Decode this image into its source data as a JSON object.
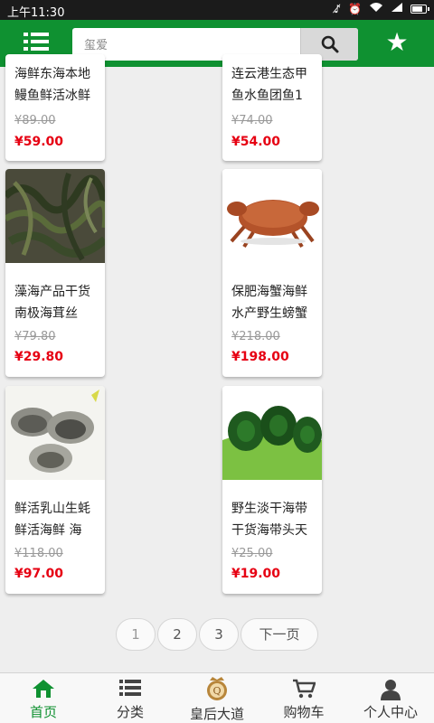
{
  "status_bar": {
    "time": "上午11:30"
  },
  "header": {
    "search_placeholder": "玺爱",
    "search_icon": "search-icon",
    "menu_icon": "list-icon",
    "favorite_icon": "star-icon"
  },
  "products": [
    {
      "name": "海鲜东海本地鳗鱼鲜活冰鲜",
      "old_price": "¥89.00",
      "price": "¥59.00",
      "image": "eel-photo"
    },
    {
      "name": "连云港生态甲鱼水鱼团鱼1",
      "old_price": "¥74.00",
      "price": "¥54.00",
      "image": "turtle-photo"
    },
    {
      "name": "藻海产品干货南极海茸丝",
      "old_price": "¥79.80",
      "price": "¥29.80",
      "image": "seaweed-photo"
    },
    {
      "name": "保肥海蟹海鲜水产野生螃蟹",
      "old_price": "¥218.00",
      "price": "¥198.00",
      "image": "crab-photo"
    },
    {
      "name": "鲜活乳山生蚝鲜活海鲜 海",
      "old_price": "¥118.00",
      "price": "¥97.00",
      "image": "oyster-photo"
    },
    {
      "name": "野生淡干海带干货海带头天",
      "old_price": "¥25.00",
      "price": "¥19.00",
      "image": "kelp-photo"
    }
  ],
  "pagination": {
    "pages": [
      "1",
      "2",
      "3"
    ],
    "current": "1",
    "next_label": "下一页"
  },
  "bottom_nav": [
    {
      "label": "首页",
      "icon": "home-icon",
      "active": true
    },
    {
      "label": "分类",
      "icon": "list-icon"
    },
    {
      "label": "皇后大道",
      "icon": "queen-logo-icon"
    },
    {
      "label": "购物车",
      "icon": "cart-icon"
    },
    {
      "label": "个人中心",
      "icon": "user-icon"
    }
  ],
  "colors": {
    "brand_green": "#0f9131",
    "price_red": "#e60012",
    "old_price_gray": "#999999"
  }
}
